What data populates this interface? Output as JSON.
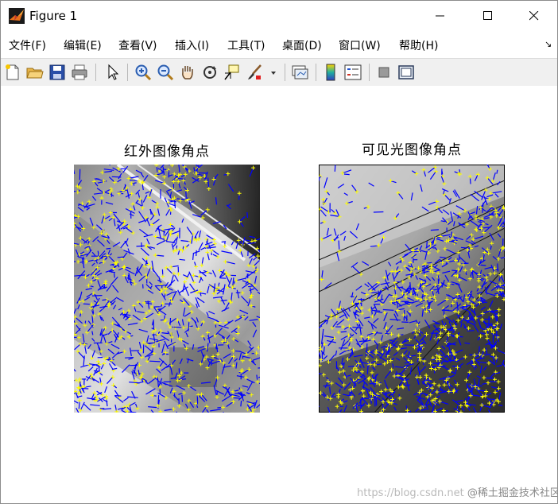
{
  "window": {
    "title": "Figure 1",
    "minimize_icon": "minimize-icon",
    "maximize_icon": "maximize-icon",
    "close_icon": "close-icon"
  },
  "menu": {
    "items": [
      {
        "label": "文件(F)"
      },
      {
        "label": "编辑(E)"
      },
      {
        "label": "查看(V)"
      },
      {
        "label": "插入(I)"
      },
      {
        "label": "工具(T)"
      },
      {
        "label": "桌面(D)"
      },
      {
        "label": "窗口(W)"
      },
      {
        "label": "帮助(H)"
      }
    ],
    "overflow_glyph": "↘"
  },
  "toolbar": {
    "buttons": [
      "new-figure-icon",
      "open-folder-icon",
      "save-icon",
      "print-icon",
      "select-arrow-icon",
      "zoom-in-icon",
      "zoom-out-icon",
      "pan-hand-icon",
      "rotate-3d-icon",
      "data-cursor-icon",
      "brush-icon",
      "brush-dropdown-icon",
      "link-plot-icon",
      "insert-colorbar-icon",
      "insert-legend-icon",
      "hide-plot-tools-icon",
      "show-plot-tools-icon"
    ]
  },
  "figure": {
    "left_title": "红外图像角点",
    "right_title": "可见光图像角点",
    "marker_colors": {
      "vector": "#0000ff",
      "point": "#ffff00"
    }
  },
  "watermark": {
    "url": "https://blog.csdn.net",
    "brand": "@稀土掘金技术社区"
  }
}
